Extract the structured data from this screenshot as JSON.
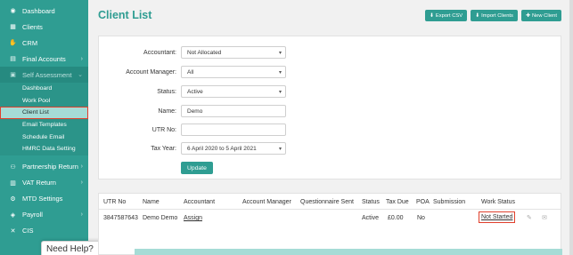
{
  "sidebar": {
    "items": [
      {
        "label": "Dashboard",
        "icon": "palette-icon"
      },
      {
        "label": "Clients",
        "icon": "building-icon"
      },
      {
        "label": "CRM",
        "icon": "handshake-icon"
      },
      {
        "label": "Final Accounts",
        "icon": "document-icon"
      },
      {
        "label": "Self Assessment",
        "icon": "folder-icon"
      }
    ],
    "sub_items": [
      {
        "label": "Dashboard"
      },
      {
        "label": "Work Pool"
      },
      {
        "label": "Client List"
      },
      {
        "label": "Email Templates"
      },
      {
        "label": "Schedule Email"
      },
      {
        "label": "HMRC Data Setting"
      }
    ],
    "lower_items": [
      {
        "label": "Partnership Return"
      },
      {
        "label": "VAT Return"
      },
      {
        "label": "MTD Settings"
      },
      {
        "label": "Payroll"
      },
      {
        "label": "CIS"
      }
    ]
  },
  "need_help": {
    "label": "Need Help?",
    "caret": "^"
  },
  "page": {
    "title": "Client List"
  },
  "header_buttons": {
    "export": "Export CSV",
    "import": "Import Clients",
    "new": "New Client"
  },
  "filters": {
    "accountant": {
      "label": "Accountant:",
      "value": "Not Allocated"
    },
    "account_manager": {
      "label": "Account Manager:",
      "value": "All"
    },
    "status": {
      "label": "Status:",
      "value": "Active"
    },
    "name": {
      "label": "Name:",
      "value": "Demo"
    },
    "utr": {
      "label": "UTR No:",
      "value": ""
    },
    "tax_year": {
      "label": "Tax Year:",
      "value": "6 April 2020 to 5 April 2021"
    },
    "update": "Update"
  },
  "table": {
    "headers": [
      "UTR No",
      "Name",
      "Accountant",
      "Account Manager",
      "Questionnaire Sent",
      "Status",
      "Tax Due",
      "POA",
      "Submission",
      "Work Status"
    ],
    "row": {
      "utr": "3847587643",
      "name": "Demo Demo",
      "accountant": "Assign",
      "account_manager": "",
      "questionnaire": "",
      "status": "Active",
      "tax_due": "£0.00",
      "poa": "No",
      "submission": "",
      "work_status": "Not Started"
    }
  },
  "colors": {
    "accent": "#2f9d92",
    "highlight": "#e0402c",
    "active_sub": "#a6dcd6"
  }
}
